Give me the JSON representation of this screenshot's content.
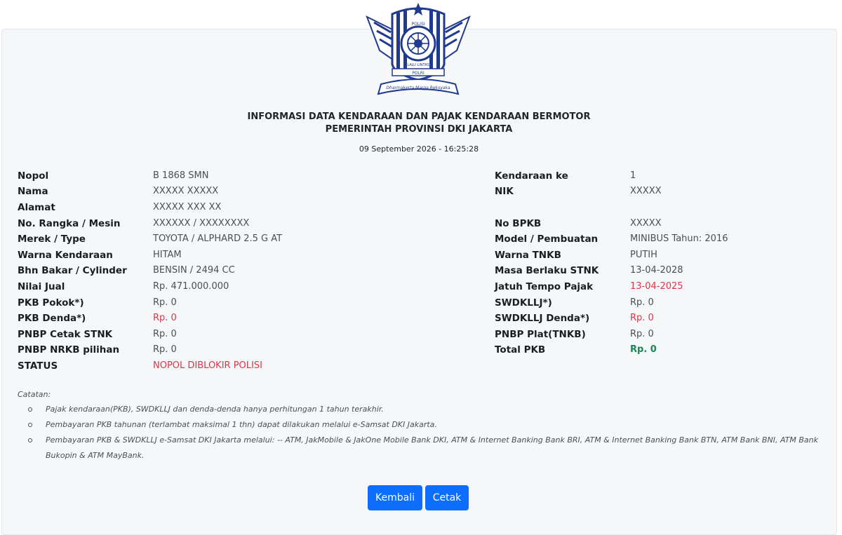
{
  "header": {
    "title_line1": "INFORMASI DATA KENDARAAN DAN PAJAK KENDARAAN BERMOTOR",
    "title_line2": "PEMERINTAH PROVINSI DKI JAKARTA",
    "datetime": "09 September 2026 - 16:25:28",
    "logo_icon": "police-traffic-emblem-icon",
    "logo_text": [
      "POLISI",
      "LALU LINTAS",
      "POLRI",
      "Dharmakerta Marga Reksyaka"
    ]
  },
  "left": [
    {
      "label": "Nopol",
      "value": "B 1868 SMN"
    },
    {
      "label": "Nama",
      "value": "XXXXX XXXXX"
    },
    {
      "label": "Alamat",
      "value": "XXXXX XXX XX"
    },
    {
      "label": "No. Rangka / Mesin",
      "value": "XXXXXX / XXXXXXXX"
    },
    {
      "label": "Merek / Type",
      "value": "TOYOTA / ALPHARD 2.5 G AT"
    },
    {
      "label": "Warna Kendaraan",
      "value": "HITAM"
    },
    {
      "label": "Bhn Bakar / Cylinder",
      "value": "BENSIN / 2494 CC"
    },
    {
      "label": "Nilai Jual",
      "value": "Rp. 471.000.000"
    },
    {
      "label": "PKB Pokok*)",
      "value": "Rp. 0"
    },
    {
      "label": "PKB Denda*)",
      "value": "Rp. 0"
    },
    {
      "label": "PNBP Cetak STNK",
      "value": "Rp. 0"
    },
    {
      "label": "PNBP NRKB pilihan",
      "value": "Rp. 0"
    },
    {
      "label": "STATUS",
      "value": "NOPOL DIBLOKIR POLISI"
    }
  ],
  "right": [
    {
      "label": "Kendaraan ke",
      "value": "1"
    },
    {
      "label": "NIK",
      "value": "XXXXX"
    },
    {
      "label": "No BPKB",
      "value": "XXXXX"
    },
    {
      "label": "Model / Pembuatan",
      "value": "MINIBUS Tahun: 2016"
    },
    {
      "label": "Warna TNKB",
      "value": "PUTIH"
    },
    {
      "label": "Masa Berlaku STNK",
      "value": "13-04-2028"
    },
    {
      "label": "Jatuh Tempo Pajak",
      "value": "13-04-2025"
    },
    {
      "label": "SWDKLLJ*)",
      "value": "Rp. 0"
    },
    {
      "label": "SWDKLLJ Denda*)",
      "value": "Rp. 0"
    },
    {
      "label": "PNBP Plat(TNKB)",
      "value": "Rp. 0"
    },
    {
      "label": "Total PKB",
      "value": "Rp. 0"
    }
  ],
  "notes": {
    "title": "Catatan:",
    "items": [
      "Pajak kendaraan(PKB), SWDKLLJ dan denda-denda hanya perhitungan 1 tahun terakhir.",
      "Pembayaran PKB tahunan (terlambat maksimal 1 thn) dapat dilakukan melalui e-Samsat DKI Jakarta.",
      "Pembayaran PKB & SWDKLLJ e-Samsat DKI Jakarta melalui: -- ATM, JakMobile & JakOne Mobile Bank DKI, ATM & Internet Banking Bank BRI, ATM & Internet Banking Bank BTN, ATM Bank BNI, ATM Bank Bukopin & ATM MayBank."
    ]
  },
  "buttons": {
    "back": "Kembali",
    "print": "Cetak"
  },
  "colors": {
    "primary": "#0d6efd",
    "danger": "#dc3545",
    "success": "#198754",
    "emblem_blue": "#1f3a8f"
  }
}
